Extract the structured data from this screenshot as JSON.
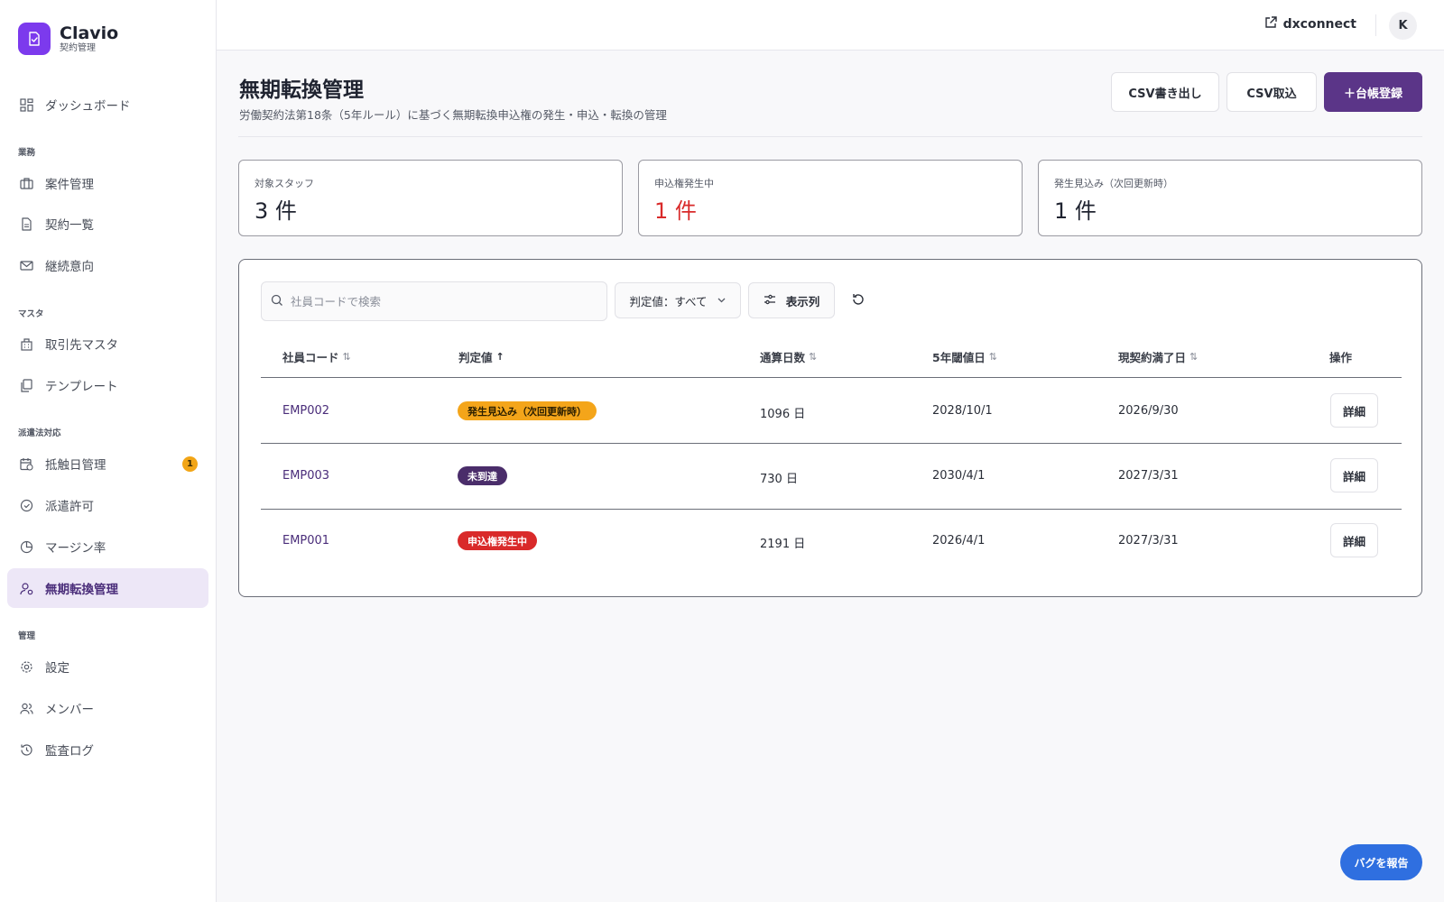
{
  "brand": {
    "name": "Clavio",
    "sub": "契約管理",
    "color": "#7c3aed"
  },
  "sidebar": {
    "dashboard": "ダッシュボード",
    "sections": [
      "業務",
      "マスタ",
      "派遣法対応",
      "管理"
    ],
    "items": [
      {
        "label": "案件管理",
        "icon": "briefcase-icon"
      },
      {
        "label": "契約一覧",
        "icon": "document-icon"
      },
      {
        "label": "継続意向",
        "icon": "mail-icon"
      },
      {
        "label": "取引先マスタ",
        "icon": "building-icon"
      },
      {
        "label": "テンプレート",
        "icon": "copy-icon"
      },
      {
        "label": "抵触日管理",
        "icon": "calendar-clock-icon",
        "badge": "1"
      },
      {
        "label": "派遣許可",
        "icon": "check-circle-icon"
      },
      {
        "label": "マージン率",
        "icon": "pie-chart-icon"
      },
      {
        "label": "無期転換管理",
        "icon": "user-convert-icon",
        "active": true
      },
      {
        "label": "設定",
        "icon": "gear-icon"
      },
      {
        "label": "メンバー",
        "icon": "users-icon"
      },
      {
        "label": "監査ログ",
        "icon": "history-icon"
      }
    ]
  },
  "topbar": {
    "link_label": "dxconnect",
    "avatar_initial": "K"
  },
  "header": {
    "title": "無期転換管理",
    "subtitle": "労働契約法第18条（5年ルール）に基づく無期転換申込権の発生・申込・転換の管理",
    "buttons": {
      "csv_export": "CSV書き出し",
      "csv_import": "CSV取込",
      "register": "＋台帳登録"
    }
  },
  "stats": [
    {
      "label": "対象スタッフ",
      "value": "3 件"
    },
    {
      "label": "申込権発生中",
      "value": "1 件",
      "color": "#d92a2a"
    },
    {
      "label": "発生見込み（次回更新時）",
      "value": "1 件"
    }
  ],
  "filters": {
    "search_placeholder": "社員コードで検索",
    "judgment": "判定値：すべて",
    "columns": "表示列"
  },
  "table": {
    "columns": [
      "社員コード",
      "判定値",
      "通算日数",
      "5年閾値日",
      "現契約満了日",
      "操作"
    ],
    "rows": [
      {
        "code": "EMP002",
        "status": "発生見込み（次回更新時）",
        "status_color": "#f4a51a",
        "days": "1096 日",
        "threshold": "2028/10/1",
        "end": "2026/9/30",
        "action": "詳細"
      },
      {
        "code": "EMP003",
        "status": "未到達",
        "status_color": "#4a2d6a",
        "days": "730 日",
        "threshold": "2030/4/1",
        "end": "2027/3/31",
        "action": "詳細"
      },
      {
        "code": "EMP001",
        "status": "申込権発生中",
        "status_color": "#d92a2a",
        "days": "2191 日",
        "threshold": "2026/4/1",
        "end": "2027/3/31",
        "action": "詳細"
      }
    ]
  },
  "bug_report": "バグを報告"
}
